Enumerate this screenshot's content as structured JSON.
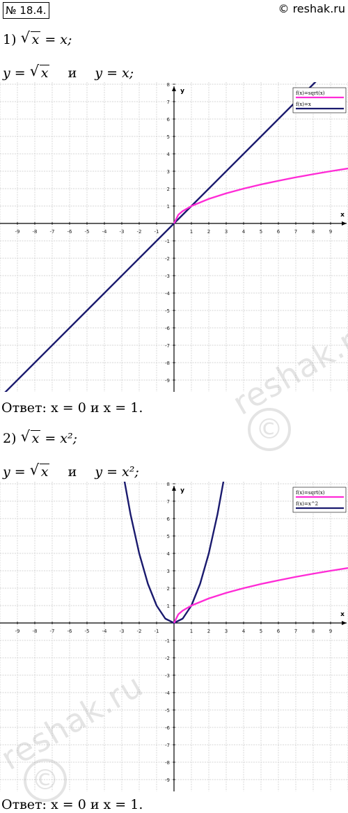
{
  "header": {
    "problem_number": "№ 18.4.",
    "site": "© reshak.ru"
  },
  "part1": {
    "label": "1)",
    "eq_left": "x",
    "eq_right": "= x;",
    "func1": "x",
    "conj": "и",
    "func2": "y = x;",
    "answer": "Ответ: x = 0 и x = 1."
  },
  "part2": {
    "label": "2)",
    "eq_left": "x",
    "eq_right": "= x²;",
    "func1": "x",
    "conj": "и",
    "func2": "y = x²;",
    "answer": "Ответ: x = 0 и x = 1."
  },
  "watermark": {
    "text": "reshak.ru",
    "symbol": "©"
  },
  "colors": {
    "sqrt_curve": "#ff2bd6",
    "second_curve": "#1a1a6e",
    "grid": "#c8c8c8",
    "axis": "#000000"
  },
  "chart_data": [
    {
      "type": "line",
      "title": "",
      "xlabel": "x",
      "ylabel": "y",
      "xlim": [
        -10,
        10
      ],
      "ylim": [
        -10,
        10
      ],
      "xticks": [
        -9,
        -8,
        -7,
        -6,
        -5,
        -4,
        -3,
        -2,
        -1,
        1,
        2,
        3,
        4,
        5,
        6,
        7,
        8,
        9
      ],
      "yticks": [
        -9,
        -8,
        -7,
        -6,
        -5,
        -4,
        -3,
        -2,
        -1,
        1,
        2,
        3,
        4,
        5,
        6,
        7,
        8,
        9
      ],
      "grid": true,
      "legend_position": "top-right",
      "series": [
        {
          "name": "f(x)=sqrt(x)",
          "x": [
            0,
            0.25,
            0.5,
            1,
            2,
            3,
            4,
            5,
            6,
            7,
            8,
            9,
            10
          ],
          "y": [
            0,
            0.5,
            0.71,
            1,
            1.41,
            1.73,
            2,
            2.24,
            2.45,
            2.65,
            2.83,
            3,
            3.16
          ]
        },
        {
          "name": "f(x)=x",
          "x": [
            -10,
            -8,
            -6,
            -4,
            -2,
            0,
            2,
            4,
            6,
            8,
            9
          ],
          "y": [
            -10,
            -8,
            -6,
            -4,
            -2,
            0,
            2,
            4,
            6,
            8,
            9
          ]
        }
      ]
    },
    {
      "type": "line",
      "title": "",
      "xlabel": "x",
      "ylabel": "y",
      "xlim": [
        -10,
        10
      ],
      "ylim": [
        -10,
        10
      ],
      "xticks": [
        -9,
        -8,
        -7,
        -6,
        -5,
        -4,
        -3,
        -2,
        -1,
        1,
        2,
        3,
        4,
        5,
        6,
        7,
        8,
        9
      ],
      "yticks": [
        -9,
        -8,
        -7,
        -6,
        -5,
        -4,
        -3,
        -2,
        -1,
        1,
        2,
        3,
        4,
        5,
        6,
        7,
        8,
        9
      ],
      "grid": true,
      "legend_position": "top-right",
      "series": [
        {
          "name": "f(x)=sqrt(x)",
          "x": [
            0,
            0.25,
            0.5,
            1,
            2,
            3,
            4,
            5,
            6,
            7,
            8,
            9,
            10
          ],
          "y": [
            0,
            0.5,
            0.71,
            1,
            1.41,
            1.73,
            2,
            2.24,
            2.45,
            2.65,
            2.83,
            3,
            3.16
          ]
        },
        {
          "name": "f(x)=x^2",
          "x": [
            -3.2,
            -3,
            -2.5,
            -2,
            -1.5,
            -1,
            -0.5,
            0,
            0.5,
            1,
            1.5,
            2,
            2.5,
            3,
            3.2
          ],
          "y": [
            10.24,
            9,
            6.25,
            4,
            2.25,
            1,
            0.25,
            0,
            0.25,
            1,
            2.25,
            4,
            6.25,
            9,
            10.24
          ]
        }
      ]
    }
  ]
}
